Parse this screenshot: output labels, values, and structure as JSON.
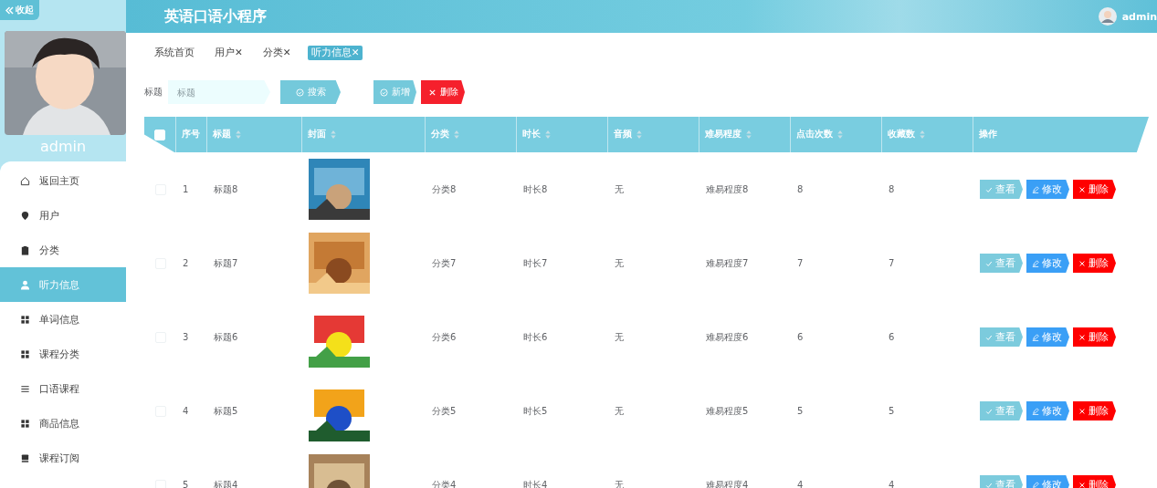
{
  "sidebar": {
    "collapse_label": "收起",
    "username": "admin",
    "items": [
      {
        "label": "返回主页",
        "kind": "home",
        "selected": false
      },
      {
        "label": "用户",
        "kind": "pin",
        "selected": false
      },
      {
        "label": "分类",
        "kind": "clipboard",
        "selected": false
      },
      {
        "label": "听力信息",
        "kind": "person",
        "selected": true
      },
      {
        "label": "单词信息",
        "kind": "grid",
        "selected": false
      },
      {
        "label": "课程分类",
        "kind": "grid",
        "selected": false
      },
      {
        "label": "口语课程",
        "kind": "list",
        "selected": false
      },
      {
        "label": "商品信息",
        "kind": "grid",
        "selected": false
      },
      {
        "label": "课程订阅",
        "kind": "monitor",
        "selected": false
      }
    ]
  },
  "header": {
    "title": "英语口语小程序",
    "user": "admin"
  },
  "tabs": [
    {
      "label": "系统首页",
      "closable": false,
      "selected": false
    },
    {
      "label": "用户",
      "closable": true,
      "selected": false
    },
    {
      "label": "分类",
      "closable": true,
      "selected": false
    },
    {
      "label": "听力信息",
      "closable": true,
      "selected": true
    }
  ],
  "close_mark": "✕",
  "search": {
    "label": "标题",
    "placeholder": "标题",
    "button": "搜索"
  },
  "toolbar": {
    "add": "新增",
    "delete": "删除"
  },
  "table": {
    "select_all_checked": false,
    "columns": [
      {
        "label": "序号",
        "sortable": false
      },
      {
        "label": "标题",
        "sortable": true
      },
      {
        "label": "封面",
        "sortable": true
      },
      {
        "label": "分类",
        "sortable": true
      },
      {
        "label": "时长",
        "sortable": true
      },
      {
        "label": "音频",
        "sortable": true
      },
      {
        "label": "难易程度",
        "sortable": true
      },
      {
        "label": "点击次数",
        "sortable": true
      },
      {
        "label": "收藏数",
        "sortable": true
      },
      {
        "label": "操作",
        "sortable": false
      }
    ],
    "rows": [
      {
        "checked": false,
        "index": "1",
        "title": "标题8",
        "category": "分类8",
        "duration": "时长8",
        "audio": "无",
        "difficulty": "难易程度8",
        "clicks": "8",
        "favorites": "8",
        "actions": [
          "查看",
          "修改",
          "删除"
        ]
      },
      {
        "checked": false,
        "index": "2",
        "title": "标题7",
        "category": "分类7",
        "duration": "时长7",
        "audio": "无",
        "difficulty": "难易程度7",
        "clicks": "7",
        "favorites": "7",
        "actions": [
          "查看",
          "修改",
          "删除"
        ]
      },
      {
        "checked": false,
        "index": "3",
        "title": "标题6",
        "category": "分类6",
        "duration": "时长6",
        "audio": "无",
        "difficulty": "难易程度6",
        "clicks": "6",
        "favorites": "6",
        "actions": [
          "查看",
          "修改",
          "删除"
        ]
      },
      {
        "checked": false,
        "index": "4",
        "title": "标题5",
        "category": "分类5",
        "duration": "时长5",
        "audio": "无",
        "difficulty": "难易程度5",
        "clicks": "5",
        "favorites": "5",
        "actions": [
          "查看",
          "修改",
          "删除"
        ]
      },
      {
        "checked": false,
        "index": "5",
        "title": "标题4",
        "category": "分类4",
        "duration": "时长4",
        "audio": "无",
        "difficulty": "难易程度4",
        "clicks": "4",
        "favorites": "4",
        "actions": [
          "查看",
          "修改",
          "删除"
        ]
      }
    ]
  }
}
